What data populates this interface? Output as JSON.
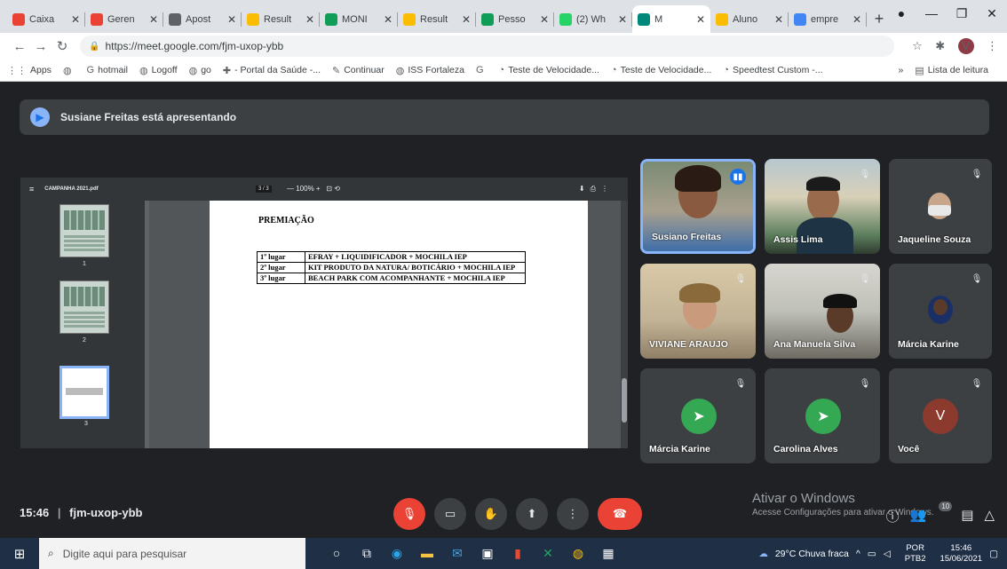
{
  "browser": {
    "tabs": [
      {
        "label": "Caixa",
        "color": "#ea4335"
      },
      {
        "label": "Geren",
        "color": "#ea4335"
      },
      {
        "label": "Apost",
        "color": "#5f6368"
      },
      {
        "label": "Result",
        "color": "#fbbc04"
      },
      {
        "label": "MONI",
        "color": "#0f9d58"
      },
      {
        "label": "Result",
        "color": "#fbbc04"
      },
      {
        "label": "Pesso",
        "color": "#0f9d58"
      },
      {
        "label": "(2) Wh",
        "color": "#25d366"
      },
      {
        "label": "M",
        "color": "#00897b"
      },
      {
        "label": "Aluno",
        "color": "#fbbc04"
      },
      {
        "label": "empre",
        "color": "#4285f4"
      }
    ],
    "active_tab": 8,
    "url": "https://meet.google.com/fjm-uxop-ybb",
    "profile_initial": "V",
    "bookmarks": [
      {
        "icon": "apps-icon",
        "label": "Apps"
      },
      {
        "icon": "globe-icon",
        "label": ""
      },
      {
        "icon": "google-icon",
        "label": "hotmail"
      },
      {
        "icon": "globe-icon",
        "label": "Logoff"
      },
      {
        "icon": "globe-icon",
        "label": "go"
      },
      {
        "icon": "health-icon",
        "label": "- Portal da Saúde -..."
      },
      {
        "icon": "bookmark-icon",
        "label": "Continuar"
      },
      {
        "icon": "globe-icon",
        "label": "ISS Fortaleza"
      },
      {
        "icon": "google-icon",
        "label": ""
      },
      {
        "icon": "speed-icon",
        "label": "Teste de Velocidade..."
      },
      {
        "icon": "speed-icon",
        "label": "Teste de Velocidade..."
      },
      {
        "icon": "speed-icon",
        "label": "Speedtest Custom -..."
      }
    ],
    "reading_list": "Lista de leitura"
  },
  "meet": {
    "presenter_text": "Susiane Freitas está apresentando",
    "pdf": {
      "filename": "CAMPANHA 2021.pdf",
      "page_indicator": "3 / 3",
      "zoom": "100%",
      "thumb_numbers": [
        "1",
        "2",
        "3"
      ],
      "doc_title": "PREMIAÇÃO",
      "prizes": [
        {
          "place": "1º lugar",
          "prize": "EFRAY + LIQUIDIFICADOR + MOCHILA IEP"
        },
        {
          "place": "2º lugar",
          "prize": "KIT PRODUTO DA NATURA/ BOTICÁRIO + MOCHILA IEP"
        },
        {
          "place": "3º lugar",
          "prize": "BEACH PARK COM ACOMPANHANTE + MOCHILA IEP"
        }
      ]
    },
    "participants": [
      {
        "name": "Susiano Freitas",
        "type": "video",
        "speaking": true
      },
      {
        "name": "Assis Lima",
        "type": "video",
        "speaking": false
      },
      {
        "name": "Jaqueline Souza",
        "type": "video",
        "speaking": false
      },
      {
        "name": "VIVIANE ARAUJO",
        "type": "video",
        "speaking": false
      },
      {
        "name": "Ana Manuela Silva",
        "type": "video",
        "speaking": false
      },
      {
        "name": "Márcia Karine",
        "type": "video",
        "speaking": false
      },
      {
        "name": "Márcia Karine",
        "type": "avatar",
        "avatar_color": "#34a853"
      },
      {
        "name": "Carolina Alves",
        "type": "avatar",
        "avatar_color": "#34a853"
      },
      {
        "name": "Você",
        "type": "avatar",
        "avatar_color": "#8d3a2e",
        "initial": "V"
      }
    ],
    "time": "15:46",
    "separator": "|",
    "meeting_code": "fjm-uxop-ybb",
    "participants_badge": "10",
    "watermark_title": "Ativar o Windows",
    "watermark_sub": "Acesse Configurações para ativar o Windows."
  },
  "taskbar": {
    "search_placeholder": "Digite aqui para pesquisar",
    "weather": "29°C  Chuva fraca",
    "lang": "POR",
    "lang_sub": "PTB2",
    "time": "15:46",
    "date": "15/06/2021"
  }
}
